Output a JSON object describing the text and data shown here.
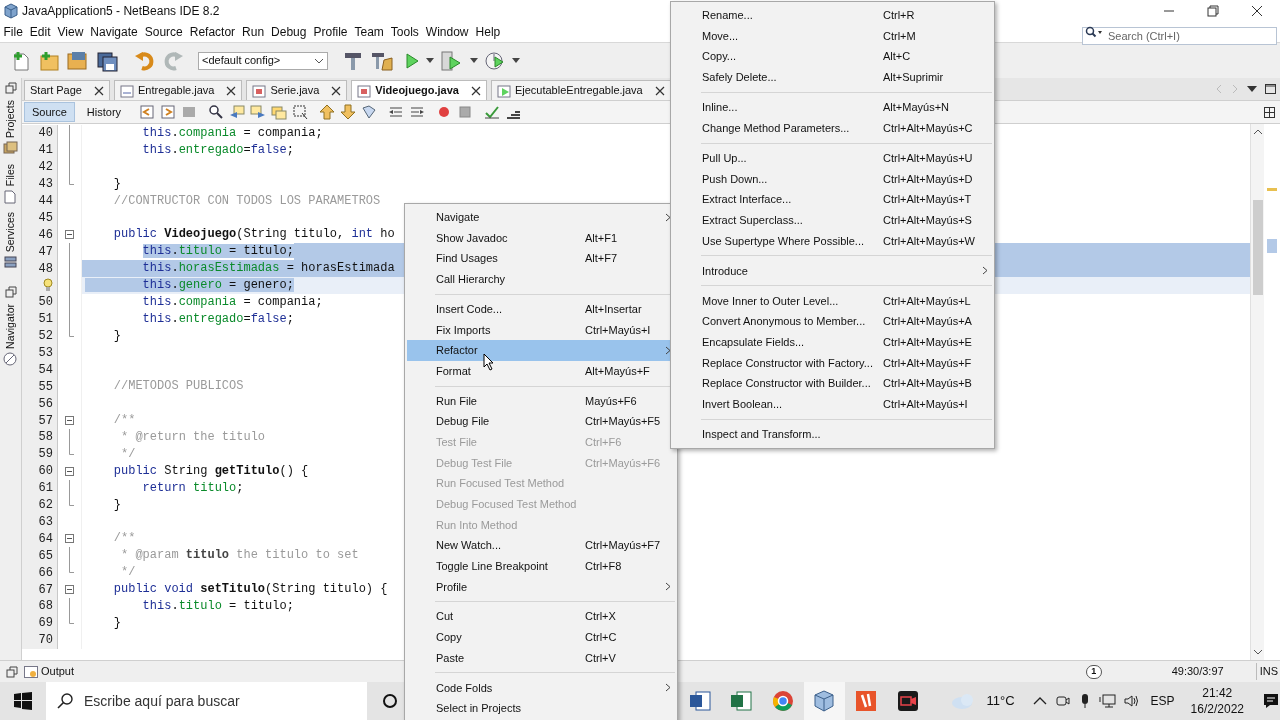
{
  "window": {
    "title": "JavaApplication5 - NetBeans IDE 8.2"
  },
  "menu_bar": [
    "File",
    "Edit",
    "View",
    "Navigate",
    "Source",
    "Refactor",
    "Run",
    "Debug",
    "Profile",
    "Team",
    "Tools",
    "Window",
    "Help"
  ],
  "toolbar": {
    "config": "<default config>"
  },
  "search": {
    "placeholder": "Search (Ctrl+I)"
  },
  "side_panels": [
    "Projects",
    "Files",
    "Services",
    "Navigator"
  ],
  "editor_tabs": [
    {
      "label": "Start Page",
      "kind": "page",
      "selected": false
    },
    {
      "label": "Entregable.java",
      "kind": "interface",
      "selected": false
    },
    {
      "label": "Serie.java",
      "kind": "class",
      "selected": false
    },
    {
      "label": "Videojuego.java",
      "kind": "class",
      "selected": true
    },
    {
      "label": "EjecutableEntregable.java",
      "kind": "main",
      "selected": false
    }
  ],
  "editor_views": [
    {
      "label": "Source",
      "selected": true
    },
    {
      "label": "History",
      "selected": false
    }
  ],
  "code_lines": [
    {
      "number": "40",
      "kind": "fold_line",
      "selected": false,
      "parts": [
        {
          "kind": "keyword",
          "text": "        this"
        },
        {
          "kind": "plain",
          "text": "."
        },
        {
          "kind": "field",
          "text": "compania"
        },
        {
          "kind": "plain",
          "text": " = compania;"
        }
      ]
    },
    {
      "number": "41",
      "kind": "fold_line",
      "selected": false,
      "parts": [
        {
          "kind": "keyword",
          "text": "        this"
        },
        {
          "kind": "plain",
          "text": "."
        },
        {
          "kind": "field",
          "text": "entregado"
        },
        {
          "kind": "plain",
          "text": "="
        },
        {
          "kind": "keyword",
          "text": "false"
        },
        {
          "kind": "plain",
          "text": ";"
        }
      ]
    },
    {
      "number": "42",
      "kind": "fold_line",
      "selected": false
    },
    {
      "number": "43",
      "kind": "fold_end",
      "selected": false,
      "parts": [
        {
          "kind": "plain",
          "text": "    }"
        }
      ]
    },
    {
      "number": "44",
      "kind": "plain",
      "selected": false,
      "parts": [
        {
          "kind": "comment",
          "text": "    //CONTRUCTOR CON TODOS LOS PARAMETROS"
        }
      ]
    },
    {
      "number": "45",
      "kind": "plain",
      "selected": false
    },
    {
      "number": "46",
      "kind": "fold_start",
      "selected": false,
      "parts": [
        {
          "kind": "keyword",
          "text": "    public "
        },
        {
          "kind": "method",
          "text": "Videojuego"
        },
        {
          "kind": "plain",
          "text": "(String titulo, "
        },
        {
          "kind": "keyword",
          "text": "int"
        },
        {
          "kind": "plain",
          "text": " ho"
        }
      ]
    },
    {
      "number": "47",
      "kind": "fold_line",
      "selected": true,
      "parts": [
        {
          "kind": "keyword",
          "text": "        this"
        },
        {
          "kind": "plain",
          "text": "."
        },
        {
          "kind": "field",
          "text": "titulo"
        },
        {
          "kind": "plain",
          "text": " = titulo;"
        }
      ]
    },
    {
      "number": "48",
      "kind": "fold_line",
      "selected": true,
      "parts": [
        {
          "kind": "keyword",
          "text": "        this"
        },
        {
          "kind": "plain",
          "text": "."
        },
        {
          "kind": "field",
          "text": "horasEstimadas"
        },
        {
          "kind": "plain",
          "text": " = horasEstimada"
        }
      ]
    },
    {
      "hint": true,
      "kind": "fold_line",
      "selected": true,
      "parts": [
        {
          "kind": "keyword",
          "text": "        this"
        },
        {
          "kind": "plain",
          "text": "."
        },
        {
          "kind": "field",
          "text": "genero"
        },
        {
          "kind": "plain",
          "text": " = genero;"
        }
      ]
    },
    {
      "number": "50",
      "kind": "fold_line",
      "selected": false,
      "parts": [
        {
          "kind": "keyword",
          "text": "        this"
        },
        {
          "kind": "plain",
          "text": "."
        },
        {
          "kind": "field",
          "text": "compania"
        },
        {
          "kind": "plain",
          "text": " = compania;"
        }
      ]
    },
    {
      "number": "51",
      "kind": "fold_line",
      "selected": false,
      "parts": [
        {
          "kind": "keyword",
          "text": "        this"
        },
        {
          "kind": "plain",
          "text": "."
        },
        {
          "kind": "field",
          "text": "entregado"
        },
        {
          "kind": "plain",
          "text": "="
        },
        {
          "kind": "keyword",
          "text": "false"
        },
        {
          "kind": "plain",
          "text": ";"
        }
      ]
    },
    {
      "number": "52",
      "kind": "fold_end",
      "selected": false,
      "parts": [
        {
          "kind": "plain",
          "text": "    }"
        }
      ]
    },
    {
      "number": "53",
      "kind": "plain",
      "selected": false
    },
    {
      "number": "54",
      "kind": "plain",
      "selected": false
    },
    {
      "number": "55",
      "kind": "plain",
      "selected": false,
      "parts": [
        {
          "kind": "comment",
          "text": "    //METODOS PUBLICOS"
        }
      ]
    },
    {
      "number": "56",
      "kind": "plain",
      "selected": false
    },
    {
      "number": "57",
      "kind": "fold_start",
      "selected": false,
      "parts": [
        {
          "kind": "comment",
          "text": "    /**"
        }
      ]
    },
    {
      "number": "58",
      "kind": "fold_line",
      "selected": false,
      "parts": [
        {
          "kind": "comment",
          "text": "     * @return the titulo"
        }
      ]
    },
    {
      "number": "59",
      "kind": "fold_end",
      "selected": false,
      "parts": [
        {
          "kind": "comment",
          "text": "     */"
        }
      ]
    },
    {
      "number": "60",
      "kind": "fold_start",
      "selected": false,
      "parts": [
        {
          "kind": "keyword",
          "text": "    public "
        },
        {
          "kind": "plain",
          "text": "String "
        },
        {
          "kind": "method",
          "text": "getTitulo"
        },
        {
          "kind": "plain",
          "text": "() {"
        }
      ]
    },
    {
      "number": "61",
      "kind": "fold_line",
      "selected": false,
      "parts": [
        {
          "kind": "keyword",
          "text": "        return "
        },
        {
          "kind": "field",
          "text": "titulo"
        },
        {
          "kind": "plain",
          "text": ";"
        }
      ]
    },
    {
      "number": "62",
      "kind": "fold_end",
      "selected": false,
      "parts": [
        {
          "kind": "plain",
          "text": "    }"
        }
      ]
    },
    {
      "number": "63",
      "kind": "plain",
      "selected": false
    },
    {
      "number": "64",
      "kind": "fold_start",
      "selected": false,
      "parts": [
        {
          "kind": "comment",
          "text": "    /**"
        }
      ]
    },
    {
      "number": "65",
      "kind": "fold_line",
      "selected": false,
      "parts": [
        {
          "kind": "comment",
          "text": "     * @param "
        },
        {
          "kind": "doc_name",
          "text": "titulo"
        },
        {
          "kind": "comment",
          "text": " the titulo to set"
        }
      ]
    },
    {
      "number": "66",
      "kind": "fold_end",
      "selected": false,
      "parts": [
        {
          "kind": "comment",
          "text": "     */"
        }
      ]
    },
    {
      "number": "67",
      "kind": "fold_start",
      "selected": false,
      "parts": [
        {
          "kind": "keyword",
          "text": "    public void "
        },
        {
          "kind": "method",
          "text": "setTitulo"
        },
        {
          "kind": "plain",
          "text": "(String titulo) {"
        }
      ]
    },
    {
      "number": "68",
      "kind": "fold_line",
      "selected": false,
      "parts": [
        {
          "kind": "keyword",
          "text": "        this"
        },
        {
          "kind": "plain",
          "text": "."
        },
        {
          "kind": "field",
          "text": "titulo"
        },
        {
          "kind": "plain",
          "text": " = titulo;"
        }
      ]
    },
    {
      "number": "69",
      "kind": "fold_end",
      "selected": false,
      "parts": [
        {
          "kind": "plain",
          "text": "    }"
        }
      ]
    },
    {
      "number": "70",
      "kind": "plain",
      "selected": false
    }
  ],
  "context_menu": {
    "items": [
      {
        "kind": "item",
        "label": "Navigate",
        "submenu": true,
        "disabled": false,
        "selected": false
      },
      {
        "kind": "item",
        "label": "Show Javadoc",
        "shortcut": "Alt+F1",
        "submenu": false,
        "disabled": false,
        "selected": false
      },
      {
        "kind": "item",
        "label": "Find Usages",
        "shortcut": "Alt+F7",
        "submenu": false,
        "disabled": false,
        "selected": false
      },
      {
        "kind": "item",
        "label": "Call Hierarchy",
        "submenu": false,
        "disabled": false,
        "selected": false
      },
      {
        "kind": "separator"
      },
      {
        "kind": "item",
        "label": "Insert Code...",
        "shortcut": "Alt+Insertar",
        "submenu": false,
        "disabled": false,
        "selected": false
      },
      {
        "kind": "item",
        "label": "Fix Imports",
        "shortcut": "Ctrl+Mayús+I",
        "submenu": false,
        "disabled": false,
        "selected": false
      },
      {
        "kind": "item",
        "label": "Refactor",
        "submenu": true,
        "disabled": false,
        "selected": true
      },
      {
        "kind": "item",
        "label": "Format",
        "shortcut": "Alt+Mayús+F",
        "submenu": false,
        "disabled": false,
        "selected": false
      },
      {
        "kind": "separator"
      },
      {
        "kind": "item",
        "label": "Run File",
        "shortcut": "Mayús+F6",
        "submenu": false,
        "disabled": false,
        "selected": false
      },
      {
        "kind": "item",
        "label": "Debug File",
        "shortcut": "Ctrl+Mayús+F5",
        "submenu": false,
        "disabled": false,
        "selected": false
      },
      {
        "kind": "item",
        "label": "Test File",
        "shortcut": "Ctrl+F6",
        "submenu": false,
        "disabled": true,
        "selected": false
      },
      {
        "kind": "item",
        "label": "Debug Test File",
        "shortcut": "Ctrl+Mayús+F6",
        "submenu": false,
        "disabled": true,
        "selected": false
      },
      {
        "kind": "item",
        "label": "Run Focused Test Method",
        "submenu": false,
        "disabled": true,
        "selected": false
      },
      {
        "kind": "item",
        "label": "Debug Focused Test Method",
        "submenu": false,
        "disabled": true,
        "selected": false
      },
      {
        "kind": "item",
        "label": "Run Into Method",
        "submenu": false,
        "disabled": true,
        "selected": false
      },
      {
        "kind": "item",
        "label": "New Watch...",
        "shortcut": "Ctrl+Mayús+F7",
        "submenu": false,
        "disabled": false,
        "selected": false
      },
      {
        "kind": "item",
        "label": "Toggle Line Breakpoint",
        "shortcut": "Ctrl+F8",
        "submenu": false,
        "disabled": false,
        "selected": false
      },
      {
        "kind": "item",
        "label": "Profile",
        "submenu": true,
        "disabled": false,
        "selected": false
      },
      {
        "kind": "separator"
      },
      {
        "kind": "item",
        "label": "Cut",
        "shortcut": "Ctrl+X",
        "submenu": false,
        "disabled": false,
        "selected": false
      },
      {
        "kind": "item",
        "label": "Copy",
        "shortcut": "Ctrl+C",
        "submenu": false,
        "disabled": false,
        "selected": false
      },
      {
        "kind": "item",
        "label": "Paste",
        "shortcut": "Ctrl+V",
        "submenu": false,
        "disabled": false,
        "selected": false
      },
      {
        "kind": "separator"
      },
      {
        "kind": "item",
        "label": "Code Folds",
        "submenu": true,
        "disabled": false,
        "selected": false
      },
      {
        "kind": "item",
        "label": "Select in Projects",
        "submenu": false,
        "disabled": false,
        "selected": false
      }
    ]
  },
  "refactor_submenu": {
    "items": [
      {
        "kind": "item",
        "label": "Rename...",
        "shortcut": "Ctrl+R",
        "submenu": false
      },
      {
        "kind": "item",
        "label": "Move...",
        "shortcut": "Ctrl+M",
        "submenu": false
      },
      {
        "kind": "item",
        "label": "Copy...",
        "shortcut": "Alt+C",
        "submenu": false
      },
      {
        "kind": "item",
        "label": "Safely Delete...",
        "shortcut": "Alt+Suprimir",
        "submenu": false
      },
      {
        "kind": "separator"
      },
      {
        "kind": "item",
        "label": "Inline...",
        "shortcut": "Alt+Mayús+N",
        "submenu": false
      },
      {
        "kind": "item",
        "label": "Change Method Parameters...",
        "shortcut": "Ctrl+Alt+Mayús+C",
        "submenu": false
      },
      {
        "kind": "separator"
      },
      {
        "kind": "item",
        "label": "Pull Up...",
        "shortcut": "Ctrl+Alt+Mayús+U",
        "submenu": false
      },
      {
        "kind": "item",
        "label": "Push Down...",
        "shortcut": "Ctrl+Alt+Mayús+D",
        "submenu": false
      },
      {
        "kind": "item",
        "label": "Extract Interface...",
        "shortcut": "Ctrl+Alt+Mayús+T",
        "submenu": false
      },
      {
        "kind": "item",
        "label": "Extract Superclass...",
        "shortcut": "Ctrl+Alt+Mayús+S",
        "submenu": false
      },
      {
        "kind": "item",
        "label": "Use Supertype Where Possible...",
        "shortcut": "Ctrl+Alt+Mayús+W",
        "submenu": false
      },
      {
        "kind": "separator"
      },
      {
        "kind": "item",
        "label": "Introduce",
        "submenu": true
      },
      {
        "kind": "separator"
      },
      {
        "kind": "item",
        "label": "Move Inner to Outer Level...",
        "shortcut": "Ctrl+Alt+Mayús+L",
        "submenu": false
      },
      {
        "kind": "item",
        "label": "Convert Anonymous to Member...",
        "shortcut": "Ctrl+Alt+Mayús+A",
        "submenu": false
      },
      {
        "kind": "item",
        "label": "Encapsulate Fields...",
        "shortcut": "Ctrl+Alt+Mayús+E",
        "submenu": false
      },
      {
        "kind": "item",
        "label": "Replace Constructor with Factory...",
        "shortcut": "Ctrl+Alt+Mayús+F",
        "submenu": false
      },
      {
        "kind": "item",
        "label": "Replace Constructor with Builder...",
        "shortcut": "Ctrl+Alt+Mayús+B",
        "submenu": false
      },
      {
        "kind": "item",
        "label": "Invert Boolean...",
        "shortcut": "Ctrl+Alt+Mayús+I",
        "submenu": false
      },
      {
        "kind": "separator"
      },
      {
        "kind": "item",
        "label": "Inspect and Transform...",
        "submenu": false
      }
    ]
  },
  "status_bar": {
    "output": "Output",
    "notifications": "1",
    "position": "49:30/3:97",
    "mode": "INS"
  },
  "taskbar": {
    "search_placeholder": "Escribe aquí para buscar",
    "weather": "11°C",
    "language": "ESP",
    "time": "21:42",
    "date": "16/2/2022"
  }
}
